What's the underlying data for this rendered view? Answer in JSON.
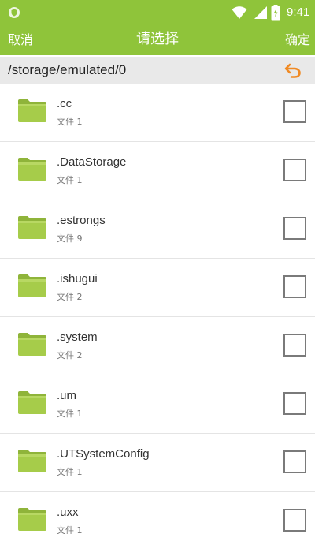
{
  "status_bar": {
    "time": "9:41",
    "icons": [
      "shield-icon",
      "wifi-icon",
      "signal-icon",
      "battery-charging-icon"
    ]
  },
  "header": {
    "cancel_label": "取消",
    "title": "请选择",
    "confirm_label": "确定",
    "background_color": "#8fc43a"
  },
  "path_bar": {
    "path": "/storage/emulated/0",
    "back_icon": "undo-arrow-icon",
    "accent_color": "#f08a24"
  },
  "files": {
    "folder_color": "#a6cc4a",
    "items": [
      {
        "name": ".cc",
        "count": "文件 1"
      },
      {
        "name": ".DataStorage",
        "count": "文件 1"
      },
      {
        "name": ".estrongs",
        "count": "文件 9"
      },
      {
        "name": ".ishugui",
        "count": "文件 2"
      },
      {
        "name": ".system",
        "count": "文件 2"
      },
      {
        "name": ".um",
        "count": "文件 1"
      },
      {
        "name": ".UTSystemConfig",
        "count": "文件 1"
      },
      {
        "name": ".uxx",
        "count": "文件 1"
      }
    ]
  }
}
